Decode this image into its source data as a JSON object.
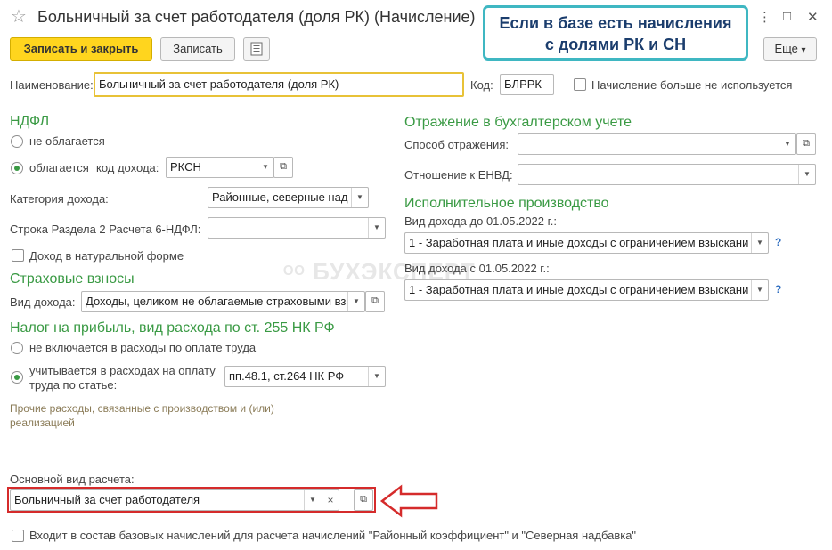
{
  "window": {
    "title": "Больничный за счет работодателя (доля РК) (Начисление)",
    "menu_icon": "more-vertical-icon",
    "maximize_icon": "maximize-icon",
    "close_icon": "close-icon"
  },
  "callout": {
    "line1": "Если в базе есть начисления",
    "line2": "с долями РК и СН"
  },
  "toolbar": {
    "save_close": "Записать и закрыть",
    "save": "Записать",
    "more": "Еще",
    "more_arrow": "▾"
  },
  "header": {
    "name_label": "Наименование:",
    "name_value": "Больничный за счет работодателя (доля РК)",
    "code_label": "Код:",
    "code_value": "БЛРРК",
    "unused_label": "Начисление больше не используется"
  },
  "ndfl": {
    "title": "НДФЛ",
    "not_taxed": "не облагается",
    "taxed": "облагается",
    "income_code_label": "код дохода:",
    "income_code_value": "РКСН",
    "category_label": "Категория дохода:",
    "category_value": "Районные, северные над",
    "row_label": "Строка Раздела 2 Расчета 6-НДФЛ:",
    "row_value": "",
    "natural_label": "Доход в натуральной форме"
  },
  "insurance": {
    "title": "Страховые взносы",
    "income_type_label": "Вид дохода:",
    "income_type_value": "Доходы, целиком не облагаемые страховыми вз"
  },
  "profit_tax": {
    "title": "Налог на прибыль, вид расхода по ст. 255 НК РФ",
    "not_included": "не включается в расходы по оплате труда",
    "included_line1": "учитывается в расходах на оплату",
    "included_line2": "труда по статье:",
    "article_value": "пп.48.1, ст.264 НК РФ",
    "other_expenses_line1": "Прочие расходы, связанные с производством и (или)",
    "other_expenses_line2": "реализацией"
  },
  "accounting": {
    "title": "Отражение в бухгалтерском учете",
    "method_label": "Способ отражения:",
    "method_value": "",
    "envd_label": "Отношение к ЕНВД:",
    "envd_value": ""
  },
  "enforcement": {
    "title": "Исполнительное производство",
    "before_label": "Вид дохода до 01.05.2022 г.:",
    "before_value": "1 - Заработная плата и иные доходы с ограничением взыскани",
    "after_label": "Вид дохода с 01.05.2022 г.:",
    "after_value": "1 - Заработная плата и иные доходы с ограничением взыскани",
    "help": "?"
  },
  "main_calc": {
    "label": "Основной вид расчета:",
    "value": "Больничный за счет работодателя",
    "clear": "×"
  },
  "base_accruals": {
    "label": "Входит в состав базовых начислений для расчета начислений \"Районный коэффициент\" и \"Северная надбавка\""
  },
  "watermark": "БУХЭКСПЕРТ",
  "colors": {
    "accent_green": "#3a9a44",
    "primary_button": "#ffd51e",
    "callout_border": "#3fb7c2",
    "highlight_red": "#d52b2b",
    "name_field_border": "#e8c237"
  }
}
